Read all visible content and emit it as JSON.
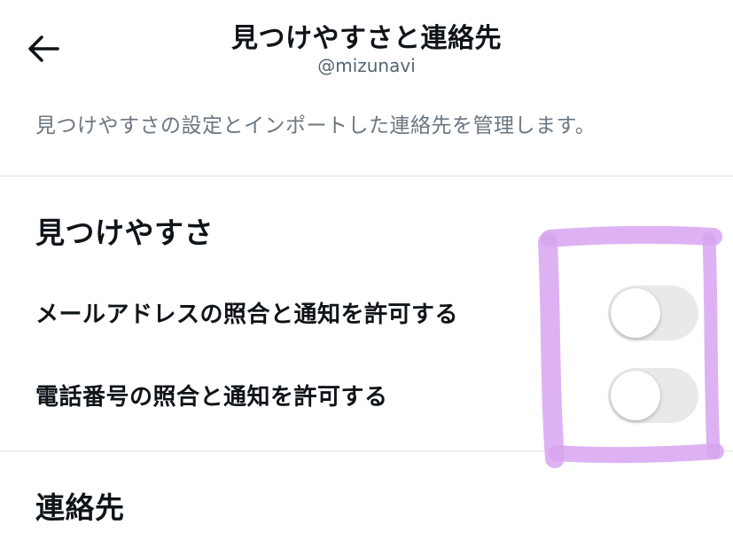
{
  "header": {
    "title": "見つけやすさと連絡先",
    "username": "@mizunavi",
    "description": "見つけやすさの設定とインポートした連絡先を管理します。"
  },
  "discoverability": {
    "section_title": "見つけやすさ",
    "settings": [
      {
        "label": "メールアドレスの照合と通知を許可する",
        "enabled": false
      },
      {
        "label": "電話番号の照合と通知を許可する",
        "enabled": false
      }
    ]
  },
  "contacts": {
    "section_title": "連絡先"
  },
  "colors": {
    "highlight": "#d8a4f0",
    "toggle_off": "#e9e9eb"
  },
  "icons": {
    "back": "arrow-left-icon"
  }
}
